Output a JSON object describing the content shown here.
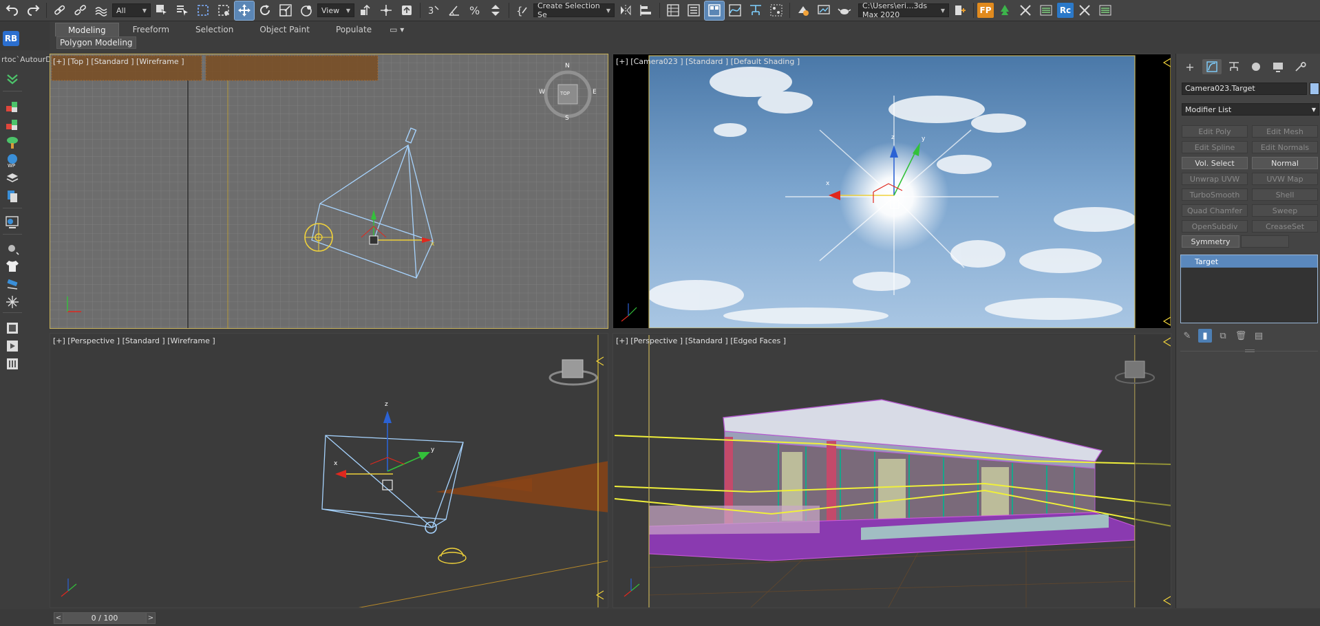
{
  "toolbar": {
    "selection_filter": "All",
    "ref_coord": "View",
    "named_selection": "Create Selection Se",
    "project_path": "C:\\Users\\eri...3ds Max 2020",
    "fp_label": "FP",
    "rc_label": "Rc"
  },
  "ribbon": {
    "tabs": [
      "Modeling",
      "Freeform",
      "Selection",
      "Object Paint",
      "Populate"
    ],
    "sub_tab": "Polygon Modeling"
  },
  "left_bar": {
    "rb_label": "RB",
    "workspace": "rtoc`AutourDe"
  },
  "viewports": {
    "top": {
      "label": "[+] [Top ] [Standard ] [Wireframe ]"
    },
    "camera": {
      "label": "[+] [Camera023 ] [Standard ] [Default Shading ]"
    },
    "perspective": {
      "label": "[+] [Perspective ] [Standard ] [Wireframe ]"
    },
    "edged": {
      "label": "[+] [Perspective ] [Standard ] [Edged Faces ]"
    }
  },
  "viewcube": {
    "n": "N",
    "s": "S",
    "e": "E",
    "w": "W",
    "face": "TOP"
  },
  "gizmo": {
    "x": "x",
    "y": "y",
    "z": "z"
  },
  "command_panel": {
    "object_name": "Camera023.Target",
    "object_color": "#9ec3ef",
    "modifier_list": "Modifier List",
    "modifiers": [
      {
        "label": "Edit Poly",
        "enabled": false
      },
      {
        "label": "Edit Mesh",
        "enabled": false
      },
      {
        "label": "Edit Spline",
        "enabled": false
      },
      {
        "label": "Edit Normals",
        "enabled": false
      },
      {
        "label": "Vol. Select",
        "enabled": true
      },
      {
        "label": "Normal",
        "enabled": true
      },
      {
        "label": "Unwrap UVW",
        "enabled": false
      },
      {
        "label": "UVW Map",
        "enabled": false
      },
      {
        "label": "TurboSmooth",
        "enabled": false
      },
      {
        "label": "Shell",
        "enabled": false
      },
      {
        "label": "Quad Chamfer",
        "enabled": false
      },
      {
        "label": "Sweep",
        "enabled": false
      },
      {
        "label": "OpenSubdiv",
        "enabled": false
      },
      {
        "label": "CreaseSet",
        "enabled": false
      }
    ],
    "symmetry": "Symmetry",
    "stack": [
      "Target"
    ]
  },
  "time_slider": {
    "value": "0 / 100"
  },
  "colors": {
    "accent": "#5b86b5",
    "viewport_border": "#c9b35a",
    "wire_blue": "#a7d4ff"
  }
}
